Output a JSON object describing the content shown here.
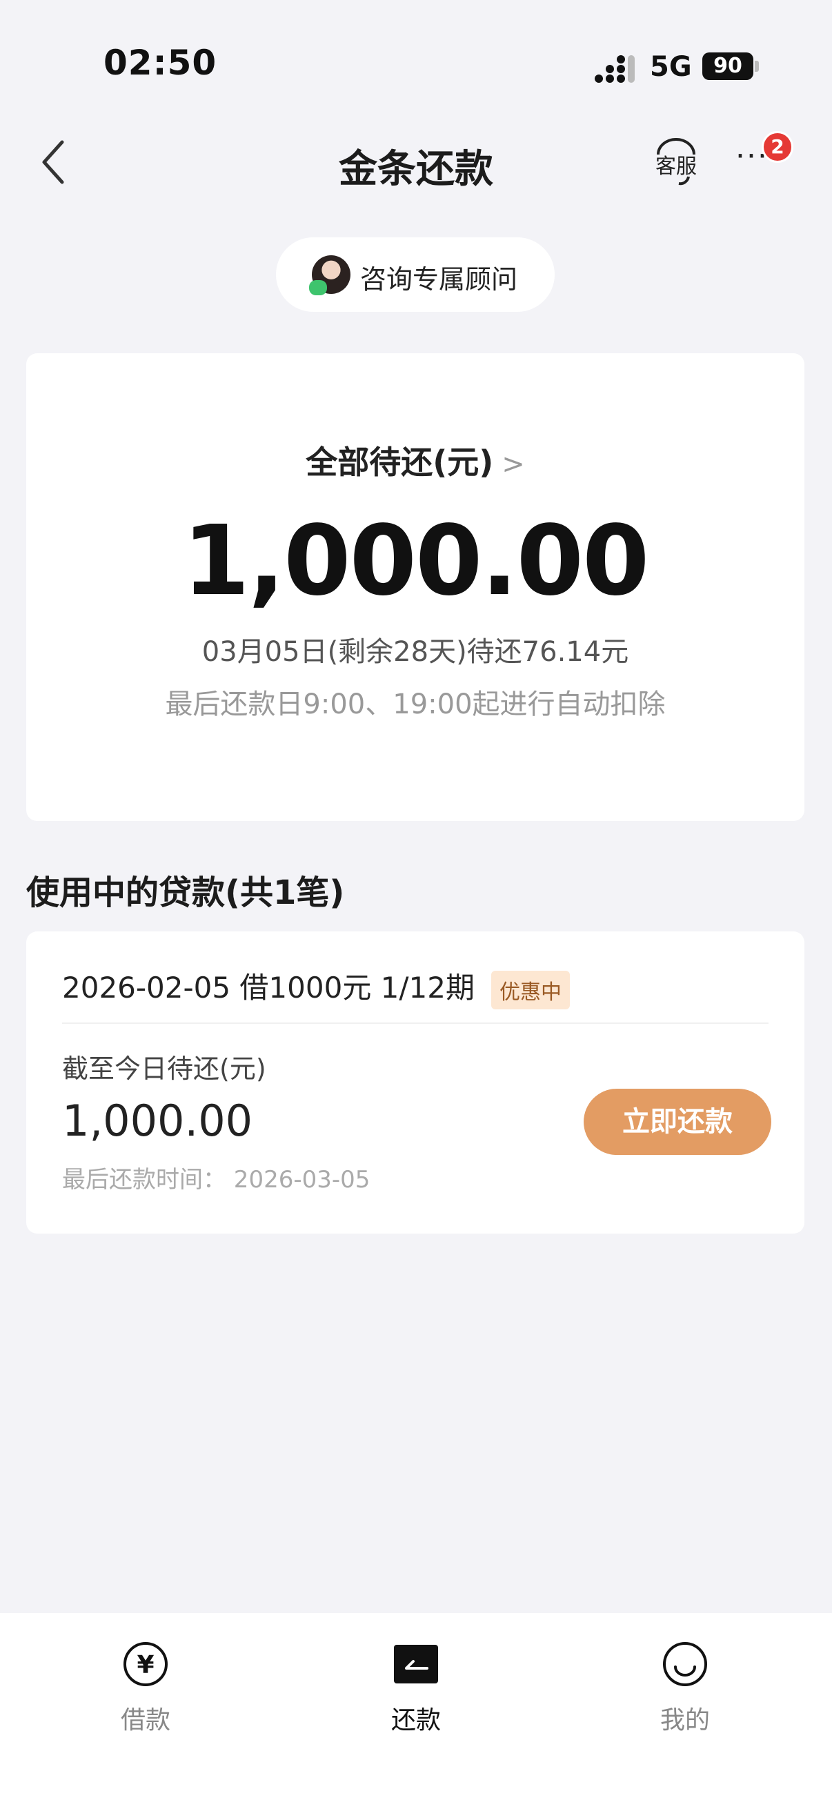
{
  "status_bar": {
    "time": "02:50",
    "network": "5G",
    "battery": "90"
  },
  "nav": {
    "title": "金条还款",
    "customer_service": "客服",
    "notification_count": "2"
  },
  "advisor_button": {
    "label": "咨询专属顾问"
  },
  "summary": {
    "title": "全部待还(元)",
    "amount": "1,000.00",
    "due_info": "03月05日(剩余28天)待还76.14元",
    "auto_deduct_note": "最后还款日9:00、19:00起进行自动扣除"
  },
  "loans_section": {
    "title": "使用中的贷款(共1笔)"
  },
  "loan": {
    "header": "2026-02-05 借1000元 1/12期",
    "promo_tag": "优惠中",
    "due_label": "截至今日待还(元)",
    "due_amount": "1,000.00",
    "last_date": "最后还款时间： 2026-03-05",
    "repay_button": "立即还款"
  },
  "tabs": [
    {
      "label": "借款",
      "icon": "yen-circle-icon"
    },
    {
      "label": "还款",
      "icon": "repay-icon",
      "active": true
    },
    {
      "label": "我的",
      "icon": "smile-face-icon"
    }
  ],
  "colors": {
    "accent": "#e39c63",
    "promo_bg": "#fde7d2",
    "badge": "#e53935"
  }
}
